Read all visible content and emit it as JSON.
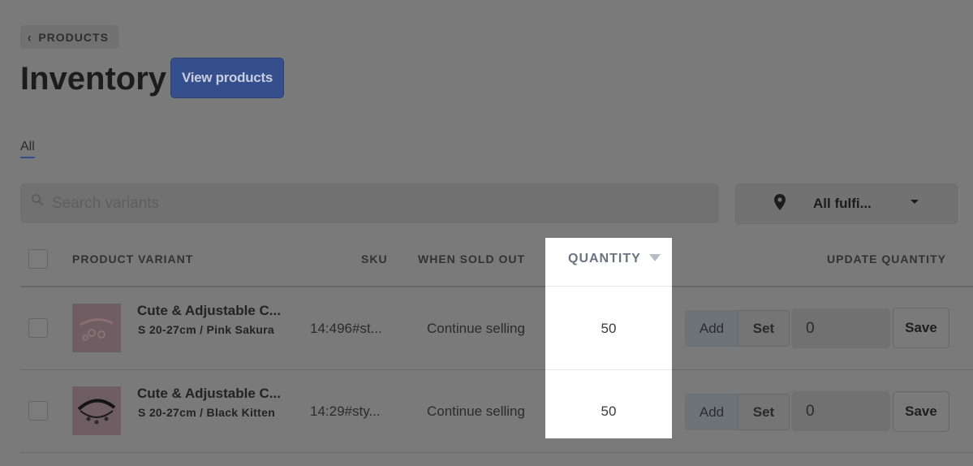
{
  "breadcrumb": {
    "label": "PRODUCTS"
  },
  "page": {
    "title": "Inventory",
    "view_products_label": "View products"
  },
  "tabs": [
    {
      "label": "All"
    }
  ],
  "search": {
    "placeholder": "Search variants"
  },
  "location_filter": {
    "label": "All fulfi..."
  },
  "table": {
    "headers": {
      "product_variant": "PRODUCT VARIANT",
      "sku": "SKU",
      "when_sold_out": "WHEN SOLD OUT",
      "quantity": "QUANTITY",
      "update_quantity": "UPDATE QUANTITY"
    },
    "rows": [
      {
        "name": "Cute & Adjustable C...",
        "variant": "S 20-27cm / Pink Sakura",
        "sku": "14:496#st...",
        "when_sold_out": "Continue selling",
        "quantity": "50",
        "add_label": "Add",
        "set_label": "Set",
        "update_value": "0",
        "save_label": "Save"
      },
      {
        "name": "Cute & Adjustable C...",
        "variant": "S 20-27cm / Black Kitten",
        "sku": "14:29#sty...",
        "when_sold_out": "Continue selling",
        "quantity": "50",
        "add_label": "Add",
        "set_label": "Set",
        "update_value": "0",
        "save_label": "Save"
      }
    ]
  },
  "colors": {
    "overlay_background": "#7a7a7a",
    "primary_button": "#354f8c",
    "highlight": "#ffffff"
  }
}
